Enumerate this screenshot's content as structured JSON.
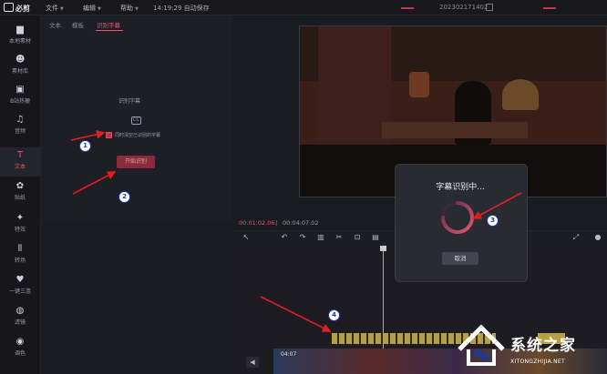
{
  "app": {
    "name": "必剪"
  },
  "menubar": {
    "file": "文件",
    "edit": "编辑",
    "help": "帮助",
    "clock": "14:19:29 自动保存",
    "project": "202302171402"
  },
  "sidebar": {
    "items": [
      {
        "label": "本地素材",
        "icon": "folder-icon"
      },
      {
        "label": "素材库",
        "icon": "library-icon"
      },
      {
        "label": "B站热梗",
        "icon": "bilibili-icon"
      },
      {
        "label": "音频",
        "icon": "music-icon"
      },
      {
        "label": "文本",
        "icon": "text-icon"
      },
      {
        "label": "贴纸",
        "icon": "sticker-icon"
      },
      {
        "label": "特效",
        "icon": "effects-icon"
      },
      {
        "label": "转场",
        "icon": "transition-icon"
      },
      {
        "label": "一键三连",
        "icon": "thumb-icon"
      },
      {
        "label": "滤镜",
        "icon": "filter-icon"
      },
      {
        "label": "调色",
        "icon": "palette-icon"
      }
    ],
    "active_index": 4,
    "accent": "#e05870"
  },
  "panel": {
    "tabs": [
      "文本",
      "模板",
      "识别字幕"
    ],
    "active_tab": 2,
    "section_title": "识别字幕",
    "checkbox_label": "同时清空已识别的字幕",
    "checkbox_checked": true,
    "start_button": "开始识别"
  },
  "player": {
    "current_time": "00:01:02.06",
    "separator": "|",
    "total_time": "00:04:07.02"
  },
  "timeline": {
    "clip_duration": "04:07"
  },
  "dialog": {
    "title": "字幕识别中...",
    "cancel": "取消"
  },
  "annotations": [
    "1",
    "2",
    "3",
    "4"
  ],
  "watermark": {
    "title": "系统之家",
    "url": "XITONGZHIJIA.NET"
  },
  "colors": {
    "annotation_arrow": "#e02020",
    "annotation_circle": "#1c3ab8",
    "spinner_start": "#e05870",
    "spinner_end": "#5a2a4a"
  }
}
